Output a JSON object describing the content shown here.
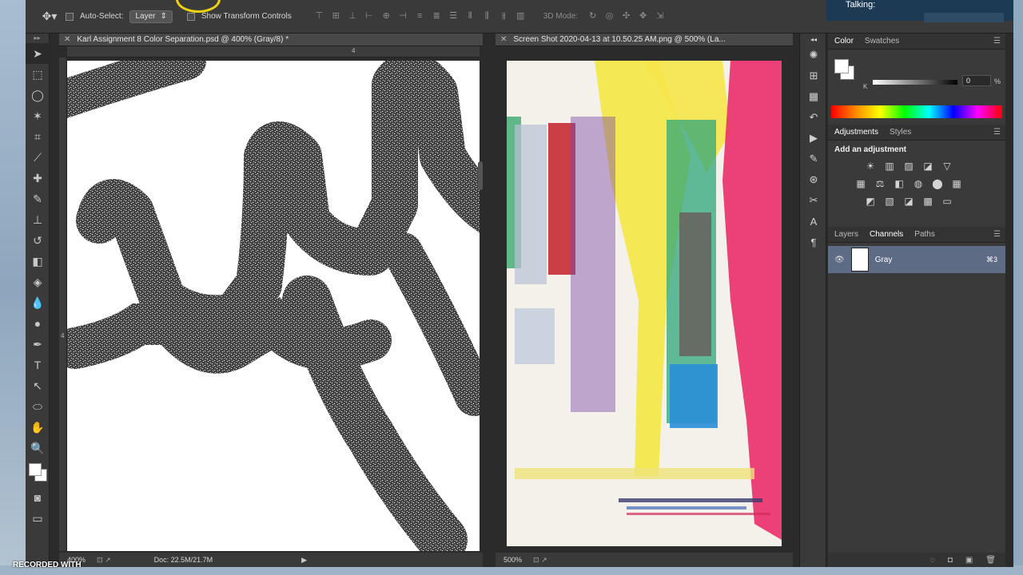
{
  "options_bar": {
    "auto_select_label": "Auto-Select:",
    "auto_select_value": "Layer",
    "show_transform_label": "Show Transform Controls",
    "mode3d_label": "3D Mode:"
  },
  "overlay": {
    "talking_label": "Talking:",
    "recorded_label": "RECORDED WITH"
  },
  "doc1": {
    "tab_title": "Karl Assignment 8 Color Separation.psd @ 400% (Gray/8) *",
    "ruler_mark": "4",
    "ruler_mark_v": "4",
    "zoom": "400%",
    "doc_size": "Doc: 22.5M/21.7M"
  },
  "doc2": {
    "tab_title": "Screen Shot 2020-04-13 at 10.50.25 AM.png @ 500% (La...",
    "zoom": "500%"
  },
  "panels": {
    "color_tabs": [
      "Color",
      "Swatches"
    ],
    "k_label": "K",
    "k_value": "0",
    "k_unit": "%",
    "adjust_tabs": [
      "Adjustments",
      "Styles"
    ],
    "add_adjustment": "Add an adjustment",
    "layer_tabs": [
      "Layers",
      "Channels",
      "Paths"
    ],
    "channel_name": "Gray",
    "channel_shortcut": "⌘3"
  },
  "colors": {
    "app_bg": "#2b2b2b",
    "panel_bg": "#3a3a3a",
    "selected_row": "#5d6b85",
    "highlight_ring": "#f1d312"
  }
}
